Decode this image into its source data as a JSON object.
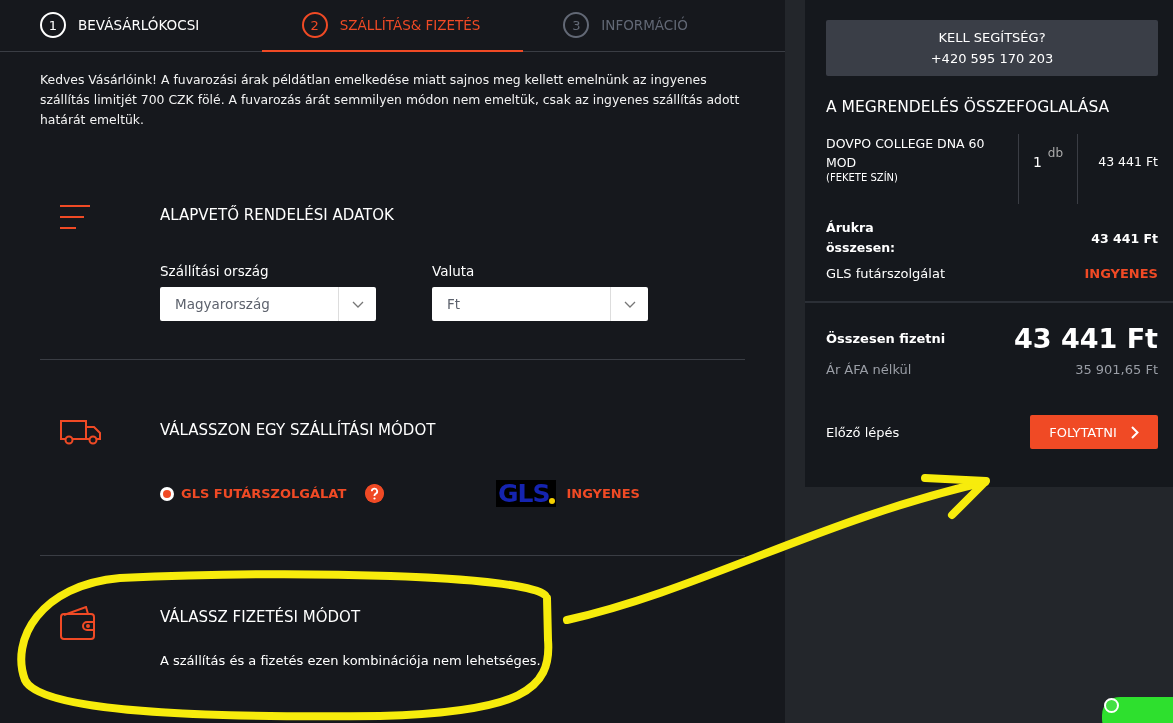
{
  "steps": [
    {
      "number": "1",
      "label": "BEVÁSÁRLÓKOCSI",
      "selected": false,
      "disabled": false
    },
    {
      "number": "2",
      "label": "SZÁLLÍTÁS& FIZETÉS",
      "selected": true,
      "disabled": false
    },
    {
      "number": "3",
      "label": "INFORMÁCIÓ",
      "selected": false,
      "disabled": true
    }
  ],
  "notice": "Kedves Vásárlóink! A fuvarozási árak példátlan emelkedése miatt sajnos meg kellett emelnünk az ingyenes szállítás limitjét 700 CZK fölé. A fuvarozás árát semmilyen módon nem emeltük, csak az ingyenes szállítás adott határát emeltük.",
  "sections": [
    {
      "kind": "order_details",
      "title": "ALAPVETŐ RENDELÉSI ADATOK",
      "fields": [
        {
          "label": "Szállítási ország",
          "value": "Magyarország"
        },
        {
          "label": "Valuta",
          "value": "Ft"
        }
      ]
    },
    {
      "kind": "shipping",
      "title": "VÁLASSZON EGY SZÁLLÍTÁSI MÓDOT",
      "options": [
        {
          "label": "GLS FUTÁRSZOLGÁLAT",
          "selected": true,
          "logo": "GLS",
          "price": "INGYENES"
        }
      ]
    },
    {
      "kind": "payment",
      "title": "VÁLASSZ FIZETÉSI MÓDOT",
      "message": "A szállítás és a fizetés ezen kombinációja nem lehetséges."
    }
  ],
  "summary": {
    "help_title": "KELL SEGÍTSÉG?",
    "help_phone": "+420 595 170 203",
    "title": "A MEGRENDELÉS ÖSSZEFOGLALÁSA",
    "items": [
      {
        "name": "DOVPO COLLEGE DNA 60 MOD",
        "variant": "(FEKETE SZÍN)",
        "quantity": "1",
        "unit": "db",
        "price": "43 441 Ft"
      }
    ],
    "subtotal_label": "Árukra összesen:",
    "subtotal": "43 441 Ft",
    "shipping_label": "GLS futárszolgálat",
    "shipping_price": "INGYENES",
    "total_label": "Összesen fizetni",
    "total": "43 441 Ft",
    "net_label": "Ár ÁFA nélkül",
    "net": "35 901,65 Ft",
    "back_link": "Előző lépés",
    "continue_button": "FOLYTATNI"
  }
}
